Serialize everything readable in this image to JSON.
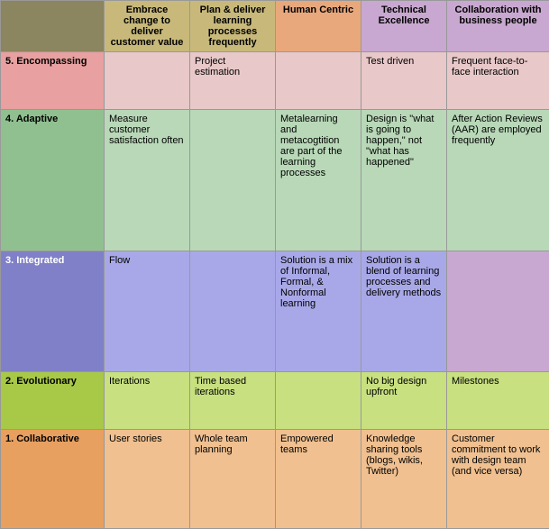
{
  "header": {
    "col0": "",
    "col1": "Embrace change to deliver customer value",
    "col2": "Plan & deliver learning processes frequently",
    "col3": "Human Centric",
    "col4": "Technical Excellence",
    "col5": "Collaboration with business people"
  },
  "rows": [
    {
      "id": "r5",
      "label": "5. Encompassing",
      "c1": "",
      "c2": "Project estimation",
      "c3": "",
      "c4": "Test driven",
      "c5": "Frequent face-to-face interaction"
    },
    {
      "id": "r4",
      "label": "4. Adaptive",
      "c1": "Measure customer satisfaction often",
      "c2": "",
      "c3": "Metalearning and metacogtition are part of the learning processes",
      "c4": "Design is \"what is going to happen,\" not \"what has happened\"",
      "c5": "After Action Reviews (AAR) are employed frequently"
    },
    {
      "id": "r3",
      "label": "3. Integrated",
      "c1": "Flow",
      "c2": "",
      "c3": "Solution is a mix of Informal, Formal, & Nonformal learning",
      "c4": "Solution is a blend of learning processes and delivery methods",
      "c5": ""
    },
    {
      "id": "r2",
      "label": "2. Evolutionary",
      "c1": "Iterations",
      "c2": "Time based iterations",
      "c3": "",
      "c4": "No big design upfront",
      "c5": "Milestones"
    },
    {
      "id": "r1",
      "label": "1. Collaborative",
      "c1": "User stories",
      "c2": "Whole team planning",
      "c3": "Empowered teams",
      "c4": "Knowledge sharing tools (blogs, wikis, Twitter)",
      "c5": "Customer commitment to work with design team (and vice versa)"
    }
  ]
}
